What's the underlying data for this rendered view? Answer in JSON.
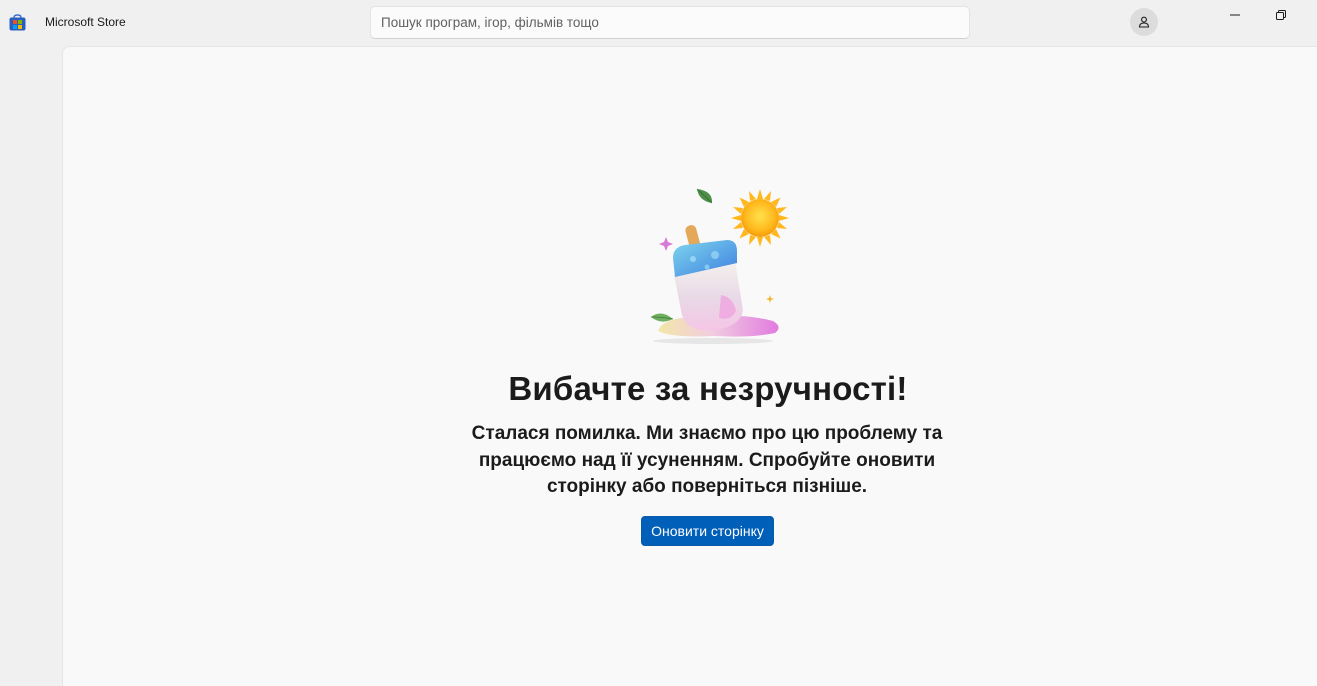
{
  "app": {
    "title": "Microsoft Store",
    "logo_icon": "microsoft-store-icon"
  },
  "search": {
    "placeholder": "Пошук програм, ігор, фільмів тощо",
    "value": ""
  },
  "header": {
    "account_icon": "person-icon"
  },
  "window_controls": {
    "minimize_icon": "minimize-icon",
    "restore_icon": "restore-icon"
  },
  "error": {
    "illustration": "melting-popsicle-icon",
    "title": "Вибачте за незручності!",
    "message": "Сталася помилка. Ми знаємо про цю проблему та працюємо над її усуненням. Спробуйте оновити сторінку або поверніться пізніше.",
    "refresh_label": "Оновити сторінку"
  },
  "colors": {
    "accent": "#005fb8",
    "background": "#f0f0f0",
    "content_background": "#f9f9f9"
  }
}
